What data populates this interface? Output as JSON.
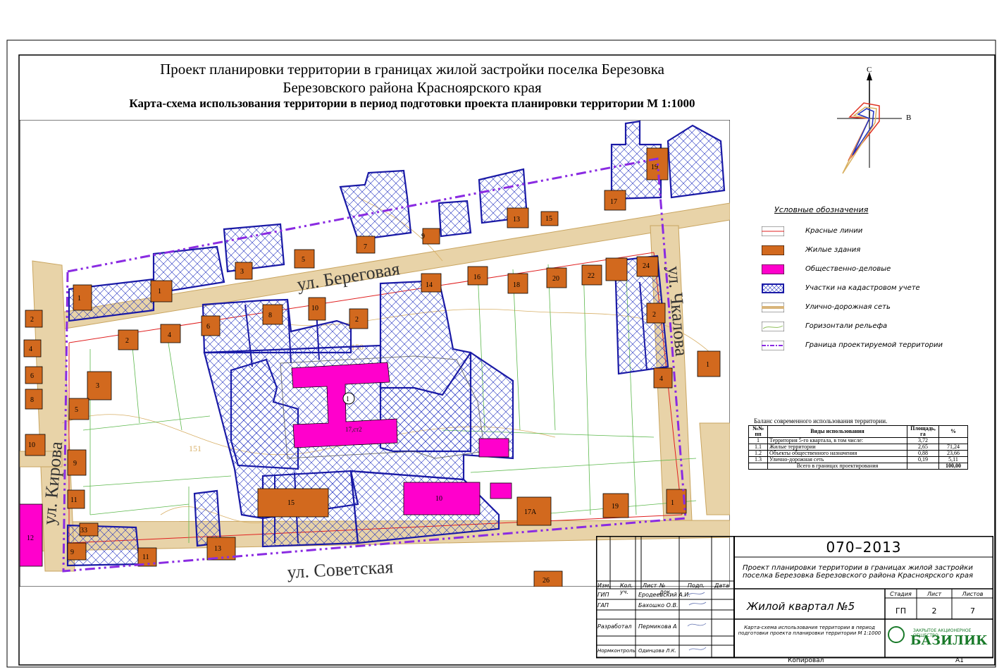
{
  "title": {
    "line1": "Проект планировки территории в границах жилой застройки поселка Березовка",
    "line2": "Березовского района Красноярского края",
    "line3": "Карта-схема использования территории в период подготовки проекта планировки территории М 1:1000"
  },
  "compass": {
    "north": "С",
    "east": "В"
  },
  "streets": {
    "beregovaya": "ул. Береговая",
    "chkalova": "ул. Чкалова",
    "kirova": "ул. Кирова",
    "sovetskaya": "ул. Советская"
  },
  "contour_labels": [
    "151",
    "150",
    "151"
  ],
  "buildings": [
    "1",
    "2",
    "3",
    "4",
    "5",
    "6",
    "7",
    "8",
    "9",
    "10",
    "11",
    "12",
    "13",
    "14",
    "15",
    "16",
    "17",
    "18",
    "19",
    "20",
    "22",
    "24",
    "26",
    "33",
    "17А"
  ],
  "public_buildings": {
    "main_number": "1",
    "main_note": "17,ст2"
  },
  "legend": {
    "header": "Условные обозначения",
    "items": [
      {
        "label": "Красные линии",
        "color": "#e02020"
      },
      {
        "label": "Жилые здания",
        "color": "#d2691e"
      },
      {
        "label": "Общественно-деловые",
        "color": "#ff00cc"
      },
      {
        "label": "Участки на кадастровом учете",
        "color": "#1a1aa6"
      },
      {
        "label": "Улично-дорожная сеть",
        "color": "#d8b47a"
      },
      {
        "label": "Горизонтали рельефа",
        "color": "#8fbf5a"
      },
      {
        "label": "Граница проектируемой территории",
        "color": "#8a2be2"
      }
    ]
  },
  "balance": {
    "caption": "Баланс современного использования территории.",
    "headers": [
      "№№ пп",
      "Виды использования",
      "Площадь, га",
      "%"
    ],
    "rows": [
      [
        "1",
        "Территория 5-го квартала, в том числе:",
        "3,72",
        ""
      ],
      [
        "1.1",
        "Жилые территории",
        "2,65",
        "71,24"
      ],
      [
        "1.2",
        "Объекты общественного назначения",
        "0,88",
        "23,66"
      ],
      [
        "1.3",
        "Улично-дорожная сеть",
        "0,19",
        "5,11"
      ],
      [
        "",
        "Всего в границах проектирования",
        "",
        "100,00"
      ]
    ]
  },
  "stamp": {
    "code": "070–2013",
    "project": "Проект планировки территории в границах жилой застройки поселка Березовка Березовского района Красноярского края",
    "object": "Жилой квартал №5",
    "sheet_title": "Карта-схема использования территории в период подготовки проекта планировки территории М 1:1000",
    "headers": [
      "Изм.",
      "Кол. уч.",
      "Лист",
      "№ док.",
      "Подп.",
      "Дата"
    ],
    "stage_label": "Стадия",
    "sheet_label": "Лист",
    "sheets_label": "Листов",
    "stage": "ГП",
    "sheet": "2",
    "sheets": "7",
    "roles": [
      {
        "role": "ГИП",
        "name": "Еродеевский А.И."
      },
      {
        "role": "ГАП",
        "name": "Бахошко О.В."
      },
      {
        "role": "Разработал",
        "name": "Пермикова А"
      },
      {
        "role": "Нормконтроль",
        "name": "Одинцова Л.К."
      }
    ],
    "company_small": "ЗАКРЫТОЕ АКЦИОНЕРНОЕ ОБЩЕСТВО",
    "company": "БАЗИЛИК",
    "copied": "Копировал",
    "format": "А1"
  }
}
